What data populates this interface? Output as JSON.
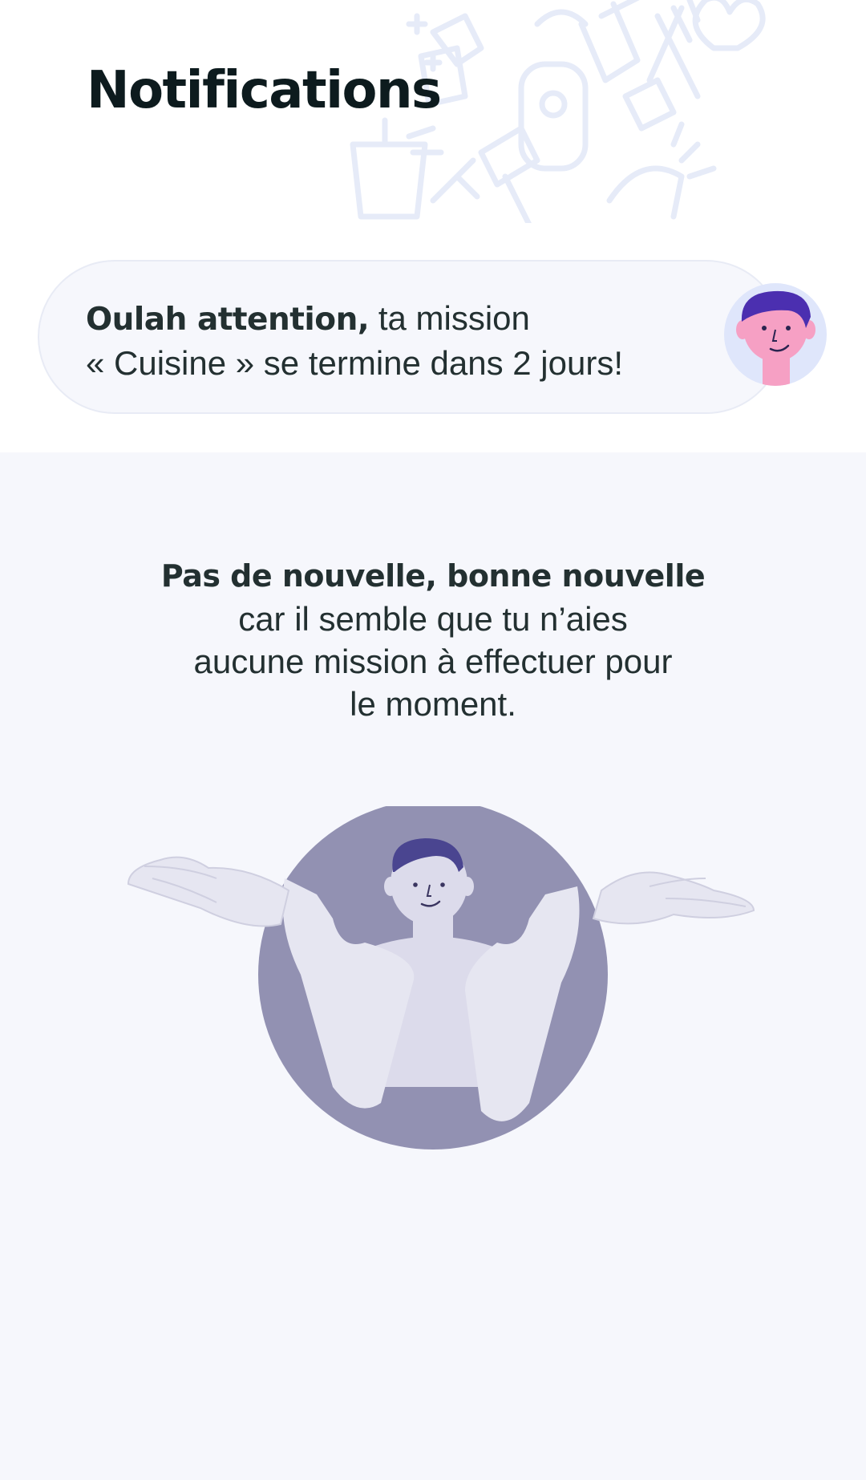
{
  "header": {
    "title": "Notifications",
    "pattern": "household-cleaning-tools-doodle"
  },
  "notification": {
    "bold_prefix": "Oulah attention,",
    "message_line1": " ta mission",
    "message_line2": "« Cuisine » se termine dans 2 jours!",
    "avatar": "boy-avatar"
  },
  "empty_state": {
    "headline": "Pas de nouvelle, bonne nouvelle",
    "line1": "car il semble que tu n’aies",
    "line2": "aucune mission à effectuer pour",
    "line3": "le moment.",
    "illustration": "shrugging-person"
  },
  "colors": {
    "background": "#f6f7fc",
    "title": "#0d1b1e",
    "text": "#233031",
    "pattern": "#e6ebf8",
    "avatar_hair": "#4b2fb0",
    "avatar_skin": "#f6a0c4",
    "avatar_bg": "#dfe6fb",
    "illustration_circle": "#9291b2",
    "illustration_person": "#e6e6f1"
  }
}
